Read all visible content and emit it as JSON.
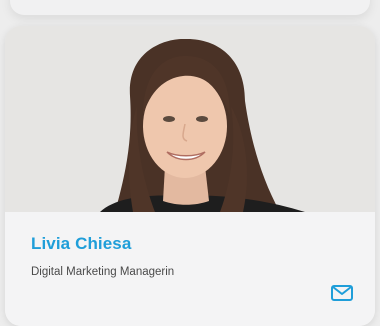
{
  "profile": {
    "name": "Livia Chiesa",
    "role": "Digital Marketing Managerin"
  },
  "icons": {
    "contact": "mail-icon"
  },
  "colors": {
    "accent": "#1f9ed9",
    "card_bg": "#f4f4f5",
    "page_bg": "#ededed",
    "text_secondary": "#4a4a4a"
  }
}
